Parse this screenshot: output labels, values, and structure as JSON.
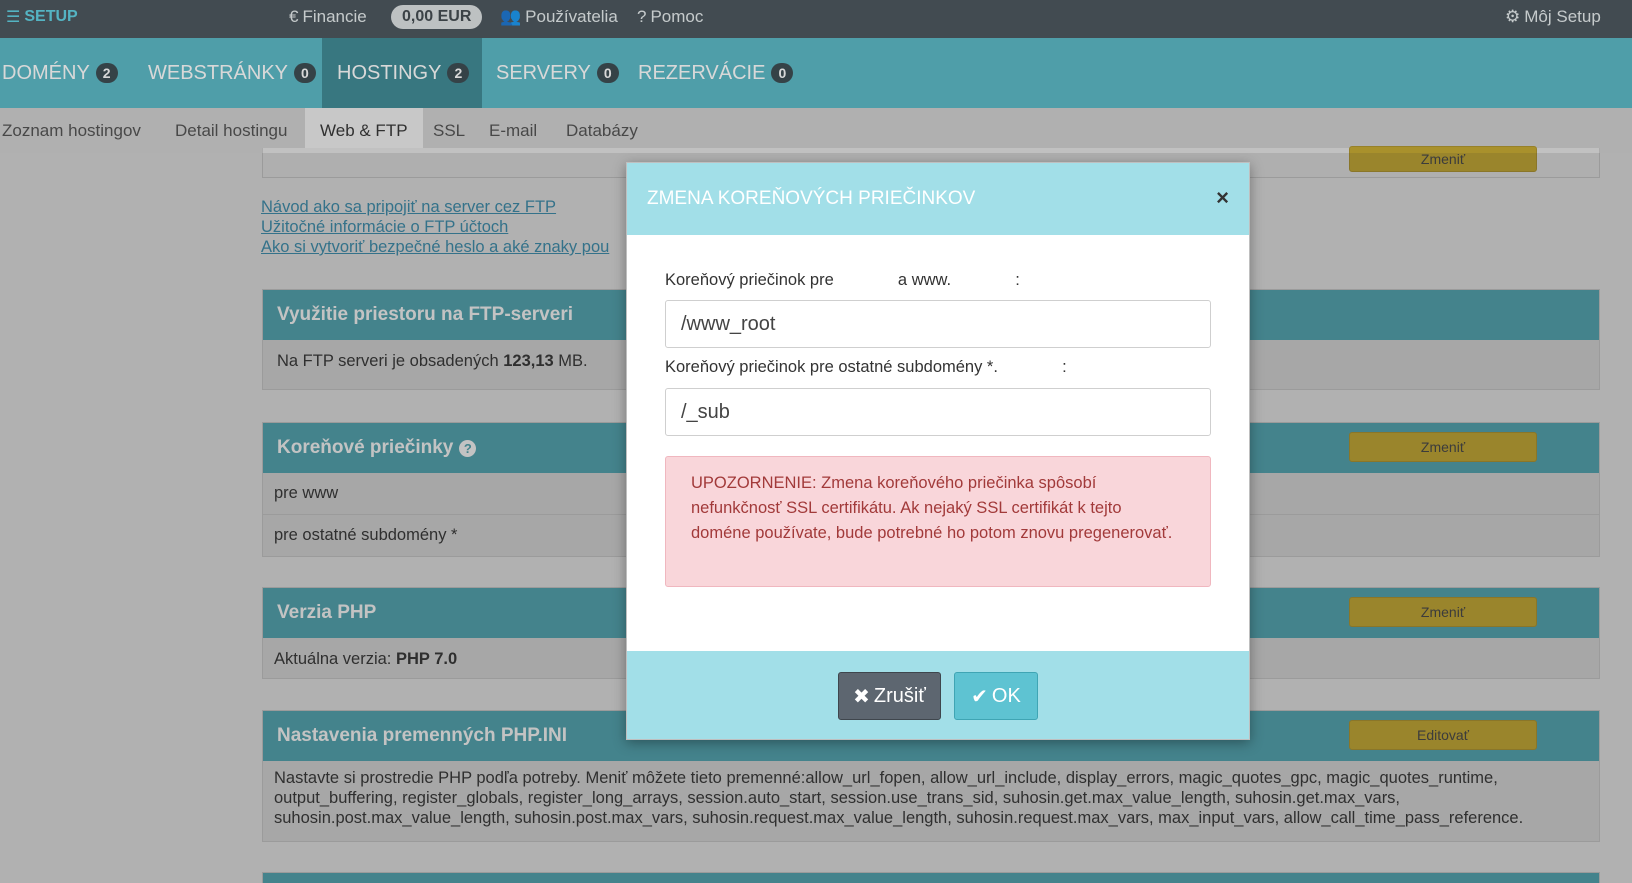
{
  "topbar": {
    "brand": "SETUP",
    "financie": "Financie",
    "balance": "0,00 EUR",
    "pouzivatelia": "Používatelia",
    "pomoc": "Pomoc",
    "moj_setup": "Môj Setup"
  },
  "main_tabs": [
    {
      "label": "DOMÉNY",
      "count": "2"
    },
    {
      "label": "WEBSTRÁNKY",
      "count": "0"
    },
    {
      "label": "HOSTINGY",
      "count": "2"
    },
    {
      "label": "SERVERY",
      "count": "0"
    },
    {
      "label": "REZERVÁCIE",
      "count": "0"
    }
  ],
  "sub_tabs": [
    "Zoznam hostingov",
    "Detail hostingu",
    "Web & FTP",
    "SSL",
    "E-mail",
    "Databázy"
  ],
  "links": [
    "Návod ako sa pripojiť na server cez FTP",
    "Užitočné informácie o FTP účtoch",
    "Ako si vytvoriť bezpečné heslo a aké znaky pou"
  ],
  "ftp_panel": {
    "title": "Využitie priestoru na FTP-serveri",
    "text_prefix": "Na FTP serveri je obsadených",
    "value": "123,13",
    "unit": "MB."
  },
  "root_panel": {
    "title": "Koreňové priečinky",
    "button": "Zmeniť",
    "rows": [
      "pre            www",
      "pre ostatné subdomény *"
    ]
  },
  "php_panel": {
    "title": "Verzia PHP",
    "button": "Zmeniť",
    "label": "Aktuálna verzia:",
    "value": "PHP 7.0"
  },
  "phpini_panel": {
    "title": "Nastavenia premenných PHP.INI",
    "button": "Editovať",
    "text": "Nastavte si prostredie PHP podľa potreby. Meniť môžete tieto premenné:allow_url_fopen, allow_url_include, display_errors, magic_quotes_gpc, magic_quotes_runtime, output_buffering, register_globals, register_long_arrays, session.auto_start, session.use_trans_sid, suhosin.get.max_value_length, suhosin.get.max_vars, suhosin.post.max_value_length, suhosin.post.max_vars, suhosin.request.max_value_length, suhosin.request.max_vars, max_input_vars, allow_call_time_pass_reference."
  },
  "top_strip_button": "Zmeniť",
  "modal": {
    "title": "ZMENA KOREŇOVÝCH PRIEČINKOV",
    "close": "×",
    "label1": "Koreňový priečinok pre              a www.              :",
    "value1": "/www_root",
    "label2": "Koreňový priečinok pre ostatné subdomény *.              :",
    "value2": "/_sub",
    "warning": "UPOZORNENIE: Zmena koreňového priečinka spôsobí nefunkčnosť SSL certifikátu. Ak nejaký SSL certifikát k tejto doméne používate, bude potrebné ho potom znovu pregenerovať.",
    "cancel": "Zrušiť",
    "ok": "OK"
  },
  "colors": {
    "topbar": "#48545b",
    "tabs": "#58b9c6",
    "modal_header": "#a2dfe8",
    "warning_bg": "#f9d6da",
    "button_yellow": "#c6a92e"
  }
}
